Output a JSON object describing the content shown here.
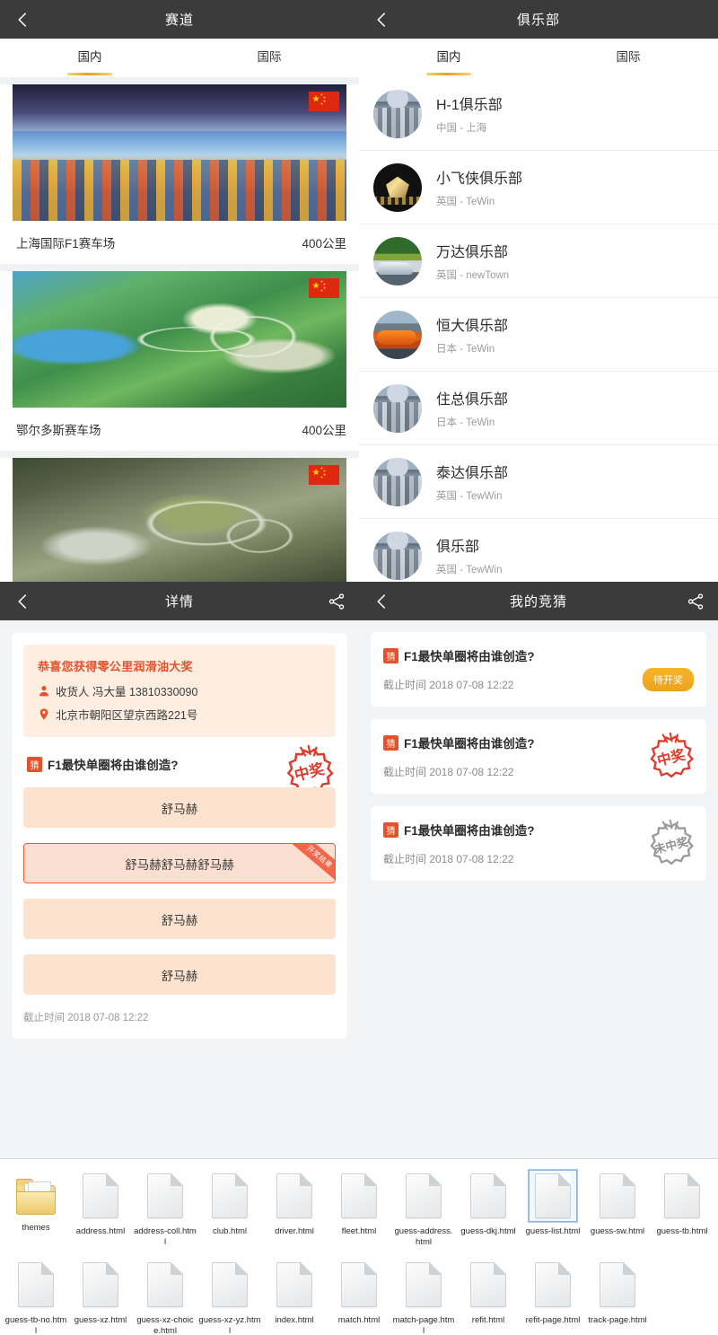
{
  "track_panel": {
    "nav": {
      "title": "赛道",
      "back_icon": "chevron-left-icon"
    },
    "tabs": [
      {
        "label": "国内",
        "active": true
      },
      {
        "label": "国际",
        "active": false
      }
    ],
    "items": [
      {
        "name": "上海国际F1赛车场",
        "distance": "400公里",
        "flag": "cn-flag-icon"
      },
      {
        "name": "鄂尔多斯赛车场",
        "distance": "400公里",
        "flag": "cn-flag-icon"
      },
      {
        "name": "",
        "distance": "",
        "flag": "cn-flag-icon"
      }
    ]
  },
  "club_panel": {
    "nav": {
      "title": "俱乐部",
      "back_icon": "chevron-left-icon"
    },
    "tabs": [
      {
        "label": "国内",
        "active": true
      },
      {
        "label": "国际",
        "active": false
      }
    ],
    "items": [
      {
        "name": "H-1俱乐部",
        "sub": "中国 - 上海"
      },
      {
        "name": "小飞侠俱乐部",
        "sub": "英国 - TeWin"
      },
      {
        "name": "万达俱乐部",
        "sub": "英国 - newTown"
      },
      {
        "name": "恒大俱乐部",
        "sub": "日本 - TeWin"
      },
      {
        "name": "住总俱乐部",
        "sub": "日本 - TeWin"
      },
      {
        "name": "泰达俱乐部",
        "sub": "英国 - TewWin"
      },
      {
        "name": "俱乐部",
        "sub": "英国 - TewWin"
      }
    ]
  },
  "detail_panel": {
    "nav": {
      "title": "详情",
      "back_icon": "chevron-left-icon",
      "share_icon": "share-icon"
    },
    "award": {
      "title": "恭喜您获得零公里润滑油大奖",
      "receiver_icon": "person-icon",
      "receiver": "收货人 冯大量 13810330090",
      "address_icon": "location-pin-icon",
      "address": "北京市朝阳区望京西路221号"
    },
    "question": {
      "badge": "猜",
      "text": "F1最快单圈将由谁创造?"
    },
    "stamp": "中奖",
    "options": [
      {
        "text": "舒马赫",
        "selected": false,
        "ribbon": ""
      },
      {
        "text": "舒马赫舒马赫舒马赫",
        "selected": true,
        "ribbon": "开奖结果"
      },
      {
        "text": "舒马赫",
        "selected": false,
        "ribbon": ""
      },
      {
        "text": "舒马赫",
        "selected": false,
        "ribbon": ""
      }
    ],
    "deadline": "截止时间 2018 07-08 12:22"
  },
  "guess_panel": {
    "nav": {
      "title": "我的竞猜",
      "back_icon": "chevron-left-icon",
      "share_icon": "share-icon"
    },
    "items": [
      {
        "badge": "猜",
        "title": "F1最快单圈将由谁创造?",
        "time": "截止时间 2018 07-08 12:22",
        "status": "待开奖",
        "status_type": "pill"
      },
      {
        "badge": "猜",
        "title": "F1最快单圈将由谁创造?",
        "time": "截止时间 2018 07-08 12:22",
        "status": "中奖",
        "status_type": "stamp-win"
      },
      {
        "badge": "猜",
        "title": "F1最快单圈将由谁创造?",
        "time": "截止时间 2018 07-08 12:22",
        "status": "未中奖",
        "status_type": "stamp-lose"
      }
    ]
  },
  "explorer": {
    "files": [
      {
        "name": "themes",
        "type": "folder",
        "selected": false
      },
      {
        "name": "address.html",
        "type": "file",
        "selected": false
      },
      {
        "name": "address-coll.html",
        "type": "file",
        "selected": false
      },
      {
        "name": "club.html",
        "type": "file",
        "selected": false
      },
      {
        "name": "driver.html",
        "type": "file",
        "selected": false
      },
      {
        "name": "fleet.html",
        "type": "file",
        "selected": false
      },
      {
        "name": "guess-address.html",
        "type": "file",
        "selected": false
      },
      {
        "name": "guess-dkj.html",
        "type": "file",
        "selected": false
      },
      {
        "name": "guess-list.html",
        "type": "file",
        "selected": true
      },
      {
        "name": "guess-sw.html",
        "type": "file",
        "selected": false
      },
      {
        "name": "guess-tb.html",
        "type": "file",
        "selected": false
      },
      {
        "name": "guess-tb-no.html",
        "type": "file",
        "selected": false
      },
      {
        "name": "guess-xz.html",
        "type": "file",
        "selected": false
      },
      {
        "name": "guess-xz-choice.html",
        "type": "file",
        "selected": false
      },
      {
        "name": "guess-xz-yz.html",
        "type": "file",
        "selected": false
      },
      {
        "name": "index.html",
        "type": "file",
        "selected": false
      },
      {
        "name": "match.html",
        "type": "file",
        "selected": false
      },
      {
        "name": "match-page.html",
        "type": "file",
        "selected": false
      },
      {
        "name": "refit.html",
        "type": "file",
        "selected": false
      },
      {
        "name": "refit-page.html",
        "type": "file",
        "selected": false
      },
      {
        "name": "track-page.html",
        "type": "file",
        "selected": false
      }
    ]
  },
  "colors": {
    "navbar": "#3b3b3b",
    "tab_active": "#e8a317",
    "accent_red": "#e8502a",
    "pill_orange": "#f0a81e",
    "award_bg": "#fdeee1",
    "option_bg": "#fbe3cf"
  }
}
